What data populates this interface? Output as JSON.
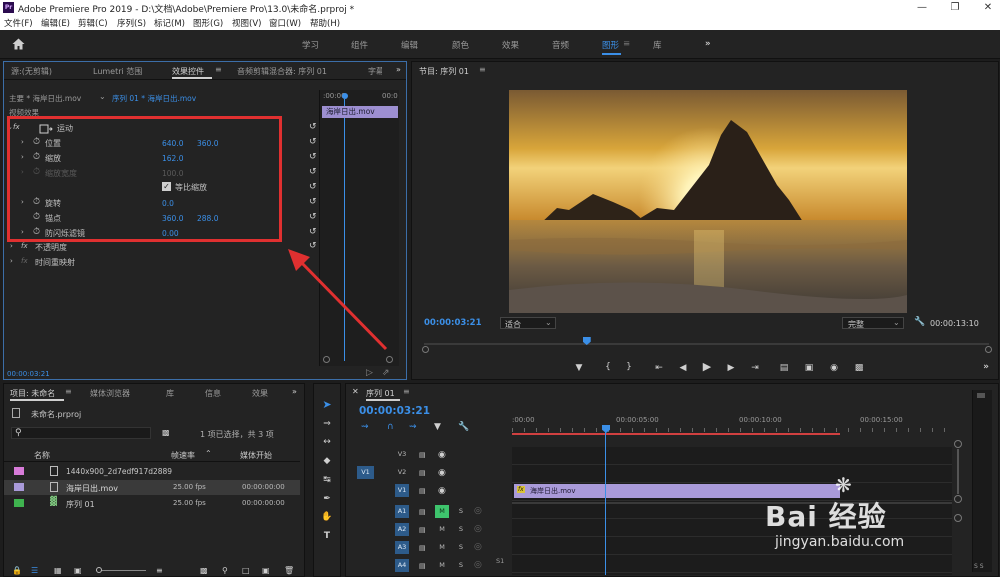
{
  "window": {
    "title": "Adobe Premiere Pro 2019 - D:\\文档\\Adobe\\Premiere Pro\\13.0\\未命名.prproj *",
    "logo": "Pr"
  },
  "menu": [
    "文件(F)",
    "编辑(E)",
    "剪辑(C)",
    "序列(S)",
    "标记(M)",
    "图形(G)",
    "视图(V)",
    "窗口(W)",
    "帮助(H)"
  ],
  "workspaces": [
    "学习",
    "组件",
    "编辑",
    "颜色",
    "效果",
    "音频",
    "图形",
    "库"
  ],
  "workspace_active": "图形",
  "top_left": {
    "tabs": [
      "源:(无剪辑)",
      "Lumetri 范围",
      "效果控件",
      "音频剪辑混合器: 序列 01",
      "字幕"
    ],
    "master": "主要 * 海岸日出.mov",
    "sequence": "序列 01 * 海岸日出.mov",
    "section": "视频效果",
    "timeline_start": ":00:00",
    "timeline_end": "00:0",
    "clip": "海岸日出.mov",
    "motion": "运动",
    "properties": [
      {
        "name": "位置",
        "v1": "640.0",
        "v2": "360.0"
      },
      {
        "name": "缩放",
        "v1": "162.0",
        "v2": ""
      },
      {
        "name": "缩放宽度",
        "v1": "100.0",
        "v2": ""
      },
      {
        "name": "旋转",
        "v1": "0.0",
        "v2": ""
      },
      {
        "name": "锚点",
        "v1": "360.0",
        "v2": "288.0"
      },
      {
        "name": "防闪烁滤镜",
        "v1": "0.00",
        "v2": ""
      }
    ],
    "uniform_scale": "等比缩放",
    "opacity": "不透明度",
    "time_remap": "时间重映射",
    "fx_label": "fx",
    "timecode": "00:00:03:21"
  },
  "program": {
    "tab": "节目: 序列 01",
    "timecode": "00:00:03:21",
    "fit": "适合",
    "quality": "完整",
    "duration": "00:00:13:10",
    "playhead_fraction": 0.288
  },
  "project": {
    "tabs": [
      "项目: 未命名",
      "媒体浏览器",
      "库",
      "信息",
      "效果"
    ],
    "file": "未命名.prproj",
    "selection": "1 项已选择，共 3 项",
    "columns": [
      "名称",
      "帧速率",
      "媒体开始"
    ],
    "items": [
      {
        "name": "1440x900_2d7edf917d2889",
        "fps": "",
        "start": "",
        "color": "#d77bd9"
      },
      {
        "name": "海岸日出.mov",
        "fps": "25.00 fps",
        "start": "00:00:00:00",
        "color": "#a99ad9"
      },
      {
        "name": "序列 01",
        "fps": "25.00 fps",
        "start": "00:00:00:00",
        "color": "#3fb34f"
      }
    ]
  },
  "timeline": {
    "tab": "序列 01",
    "timecode": "00:00:03:21",
    "ruler": [
      ":00:00",
      "00:00:05:00",
      "00:00:10:00",
      "00:00:15:00"
    ],
    "video_tracks": [
      "V3",
      "V2",
      "V1"
    ],
    "audio_tracks": [
      "A1",
      "A2",
      "A3",
      "A4"
    ],
    "source_v": "V1",
    "clip": "海岸日出.mov",
    "clip_fx": "fx",
    "mute": "M",
    "solo": "S",
    "last_label": "S1",
    "bottom_right": "S S"
  },
  "watermark": {
    "brand": "Bai 经验",
    "url": "jingyan.baidu.com"
  }
}
